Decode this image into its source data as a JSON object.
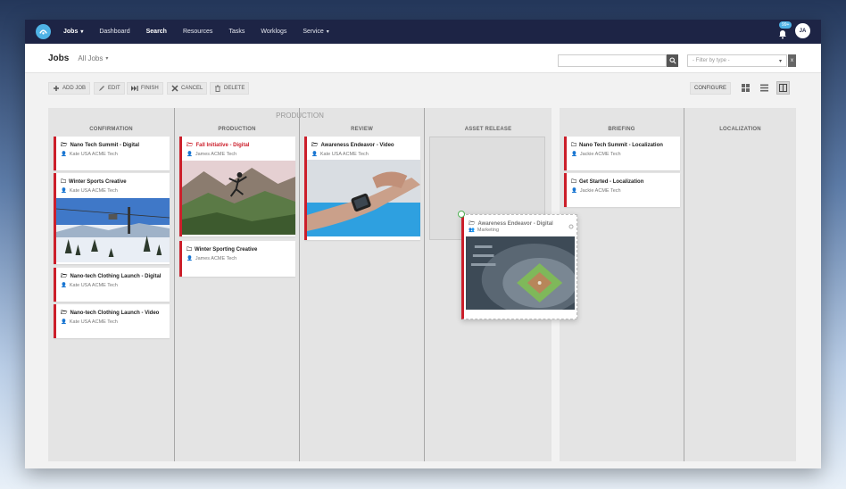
{
  "nav": {
    "items": [
      {
        "label": "Jobs",
        "dropdown": true,
        "bold": true
      },
      {
        "label": "Dashboard"
      },
      {
        "label": "Search",
        "bold": true
      },
      {
        "label": "Resources"
      },
      {
        "label": "Tasks"
      },
      {
        "label": "Worklogs"
      },
      {
        "label": "Service",
        "dropdown": true
      }
    ],
    "notification_count": "99+",
    "avatar_initials": "JA"
  },
  "header": {
    "title": "Jobs",
    "view_select": "All Jobs",
    "filter_placeholder": "- Filter by type -",
    "filter_clear": "x"
  },
  "toolbar": {
    "add_job": "ADD JOB",
    "edit": "EDIT",
    "finish": "FINISH",
    "cancel": "CANCEL",
    "delete": "DELETE",
    "configure": "CONFIGURE"
  },
  "boards": [
    {
      "title": "PRODUCTION",
      "columns": [
        {
          "title": "CONFIRMATION"
        },
        {
          "title": "PRODUCTION"
        },
        {
          "title": "REVIEW"
        },
        {
          "title": "ASSET RELEASE"
        }
      ]
    },
    {
      "title": "",
      "columns": [
        {
          "title": "BRIEFING"
        },
        {
          "title": "LOCALIZATION"
        }
      ]
    }
  ],
  "cards": {
    "c1": {
      "title": "Nano Tech Summit - Digital",
      "assignee": "Kate USA ACME Tech"
    },
    "c2": {
      "title": "Winter Sports Creative",
      "assignee": "Kate USA ACME Tech"
    },
    "c3": {
      "title": "Nano-tech Clothing Launch - Digital",
      "assignee": "Kate USA ACME Tech"
    },
    "c4": {
      "title": "Nano-tech Clothing Launch - Video",
      "assignee": "Kate USA ACME Tech"
    },
    "p1": {
      "title": "Fall Initiative - Digital",
      "assignee": "James ACME Tech"
    },
    "p2": {
      "title": "Winter Sporting Creative",
      "assignee": "James ACME Tech"
    },
    "r1": {
      "title": "Awareness Endeavor - Video",
      "assignee": "Kate USA ACME Tech"
    },
    "b1": {
      "title": "Nano Tech Summit - Localization",
      "assignee": "Jackie ACME Tech"
    },
    "b2": {
      "title": "Get Started - Localization",
      "assignee": "Jackie ACME Tech"
    },
    "drag": {
      "title": "Awareness Endeavor - Digital",
      "assignee": "Marketing"
    }
  },
  "colors": {
    "accent_red": "#cc1f2b",
    "nav_bg": "#1d2445",
    "logo_blue": "#4fb3e6"
  }
}
